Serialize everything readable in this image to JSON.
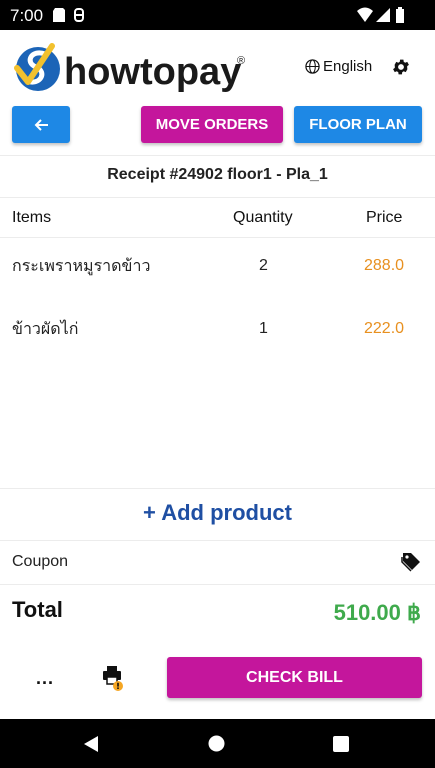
{
  "status_bar": {
    "time": "7:00"
  },
  "header": {
    "brand": "howtopay",
    "registered": "®",
    "language": "English"
  },
  "actions": {
    "move_orders": "MOVE ORDERS",
    "floor_plan": "FLOOR PLAN"
  },
  "receipt": {
    "title": "Receipt #24902  floor1 - Pla_1"
  },
  "table": {
    "columns": [
      "Items",
      "Quantity",
      "Price"
    ],
    "rows": [
      {
        "name": "กระเพราหมูราดข้าว",
        "quantity": "2",
        "price": "288.0"
      },
      {
        "name": "ข้าวผัดไก่",
        "quantity": "1",
        "price": "222.0"
      }
    ]
  },
  "add_product": "+ Add product",
  "coupon": {
    "label": "Coupon"
  },
  "total": {
    "label": "Total",
    "value": "510.00 ฿"
  },
  "footer": {
    "more": "...",
    "check_bill": "CHECK BILL"
  },
  "colors": {
    "magenta": "#c4169c",
    "blue": "#1e88e5",
    "price": "#e8901f",
    "total": "#3faa4c"
  }
}
